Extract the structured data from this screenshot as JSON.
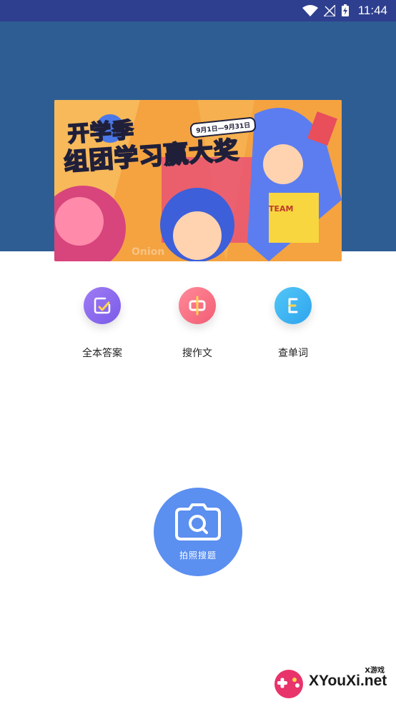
{
  "status_bar": {
    "time": "11:44"
  },
  "banner": {
    "headline_line1": "开学季",
    "headline_line2": "组团学习赢大奖",
    "date_tag": "9月1日—9月31日",
    "brand_text": "Onion",
    "team_text": "TEAM"
  },
  "features": [
    {
      "label": "全本答案",
      "icon": "checklist-icon",
      "color": "#8a68ef"
    },
    {
      "label": "搜作文",
      "icon": "chinese-zhong-icon",
      "color": "#f56b80",
      "glyph": "中"
    },
    {
      "label": "查单词",
      "icon": "english-e-icon",
      "color": "#3bb2f2",
      "glyph": "E"
    }
  ],
  "camera_button": {
    "label": "拍照搜题",
    "icon": "camera-search-icon",
    "color": "#5b8ff0"
  },
  "watermark": {
    "small": "X游戏",
    "big": "XYouXi.net"
  },
  "colors": {
    "status_bar": "#2e3f8f",
    "hero": "#2e5d93"
  }
}
